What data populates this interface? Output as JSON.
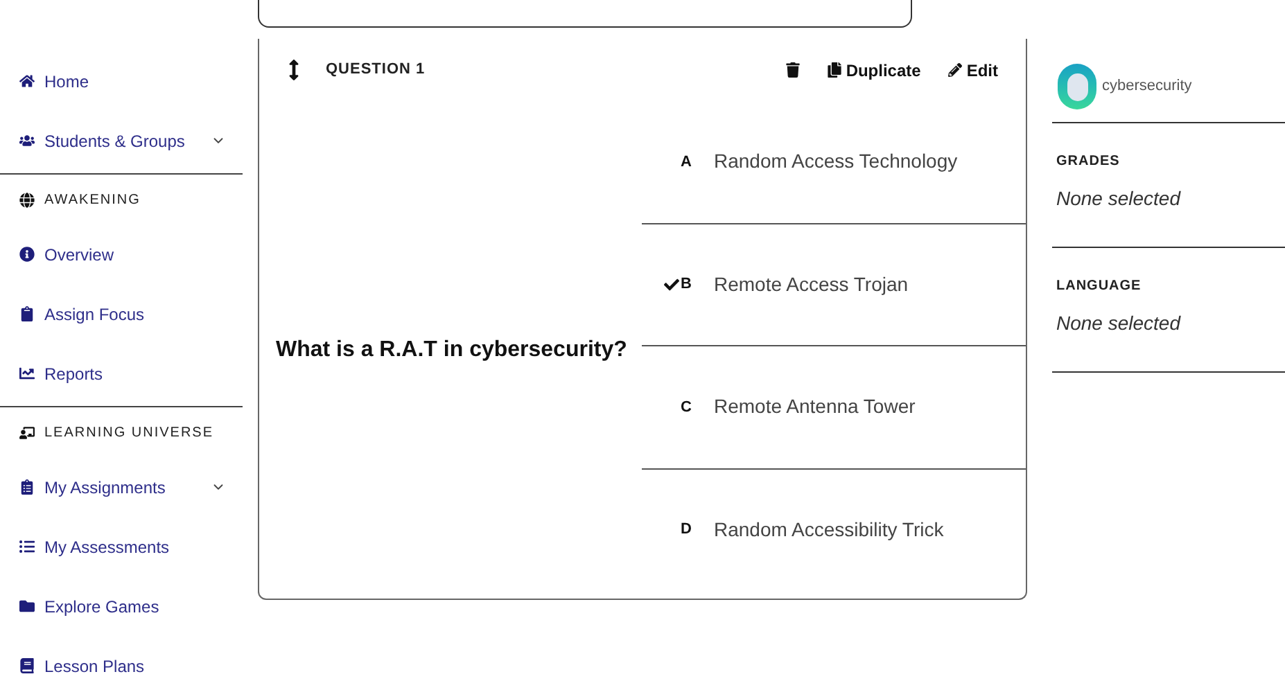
{
  "sidebar": {
    "groups": [
      {
        "items": [
          {
            "kind": "link",
            "label": "Home",
            "expandable": false
          },
          {
            "kind": "link",
            "label": "Students & Groups",
            "expandable": true
          }
        ]
      },
      {
        "heading": {
          "label": "AWAKENING"
        },
        "items": [
          {
            "kind": "link",
            "label": "Overview",
            "expandable": false
          },
          {
            "kind": "link",
            "label": "Assign Focus",
            "expandable": false
          },
          {
            "kind": "link",
            "label": "Reports",
            "expandable": false
          }
        ]
      },
      {
        "heading": {
          "label": "LEARNING UNIVERSE"
        },
        "items": [
          {
            "kind": "link",
            "label": "My Assignments",
            "expandable": true
          },
          {
            "kind": "link",
            "label": "My Assessments",
            "expandable": false
          },
          {
            "kind": "link",
            "label": "Explore Games",
            "expandable": false
          },
          {
            "kind": "link",
            "label": "Lesson Plans",
            "expandable": false
          }
        ]
      }
    ]
  },
  "question": {
    "title": "QUESTION 1",
    "actions": [
      {
        "kind": "delete"
      },
      {
        "kind": "duplicate",
        "label": "Duplicate"
      },
      {
        "kind": "edit",
        "label": "Edit"
      }
    ],
    "text": "What is a R.A.T in cybersecurity?",
    "answers": [
      {
        "letter": "A",
        "text": "Random Access Technology",
        "correct": false
      },
      {
        "letter": "B",
        "text": "Remote Access Trojan",
        "correct": true
      },
      {
        "letter": "C",
        "text": "Remote Antenna Tower",
        "correct": false
      },
      {
        "letter": "D",
        "text": "Random Accessibility Trick",
        "correct": false
      }
    ]
  },
  "details": {
    "topic": "cybersecurity",
    "filters": [
      {
        "label": "GRADES",
        "value": "None selected"
      },
      {
        "label": "LANGUAGE",
        "value": "None selected"
      }
    ]
  }
}
